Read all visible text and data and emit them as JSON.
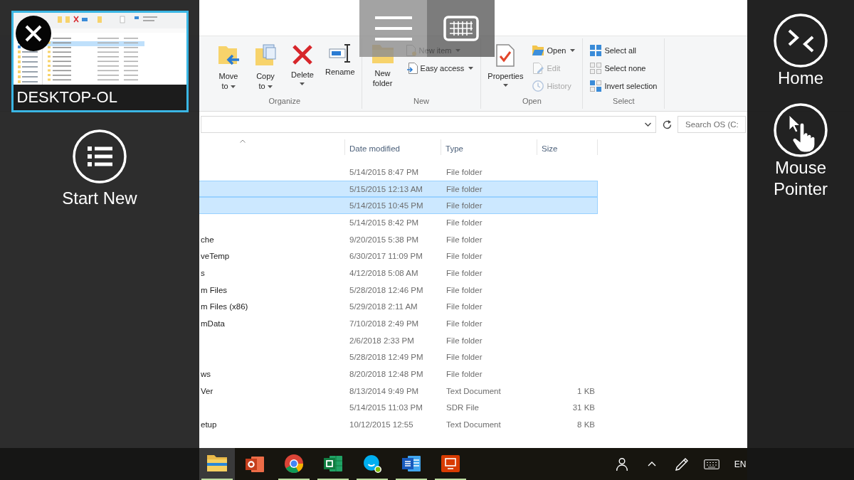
{
  "session_panel": {
    "sessions": [
      {
        "name": "DESKTOP-OL",
        "selected": true
      }
    ],
    "start_new": "Start New"
  },
  "action_panel": {
    "actions": [
      {
        "kind": "home",
        "label": "Home"
      },
      {
        "kind": "pointer",
        "label": "Mouse Pointer"
      }
    ]
  },
  "explorer": {
    "ribbon": {
      "groups": [
        {
          "label": "Organize",
          "commands": [
            {
              "kind": "large",
              "label": "Move to",
              "menu": true,
              "disabled": false
            },
            {
              "kind": "large",
              "label": "Copy to",
              "menu": true,
              "disabled": false
            },
            {
              "kind": "large",
              "label": "Delete",
              "menu": true,
              "disabled": false
            },
            {
              "kind": "large",
              "label": "Rename",
              "menu": false,
              "disabled": false
            }
          ]
        },
        {
          "label": "New",
          "commands": [
            {
              "kind": "large",
              "label": "New folder",
              "menu": false,
              "disabled": false
            },
            {
              "kind": "small",
              "label": "New item",
              "menu": true,
              "disabled": false
            },
            {
              "kind": "small",
              "label": "Easy access",
              "menu": true,
              "disabled": false
            }
          ]
        },
        {
          "label": "Open",
          "commands": [
            {
              "kind": "large",
              "label": "Properties",
              "menu": true,
              "disabled": false
            },
            {
              "kind": "small",
              "label": "Open",
              "menu": true,
              "disabled": false
            },
            {
              "kind": "small",
              "label": "Edit",
              "menu": false,
              "disabled": true
            },
            {
              "kind": "small",
              "label": "History",
              "menu": false,
              "disabled": true
            }
          ]
        },
        {
          "label": "Select",
          "commands": [
            {
              "kind": "small",
              "label": "Select all",
              "menu": false,
              "disabled": false
            },
            {
              "kind": "small",
              "label": "Select none",
              "menu": false,
              "disabled": false
            },
            {
              "kind": "small",
              "label": "Invert selection",
              "menu": false,
              "disabled": false
            }
          ]
        }
      ]
    },
    "search": {
      "placeholder": "Search OS (C:"
    },
    "file_list": {
      "columns": [
        {
          "sorted": true
        },
        {
          "label": "Date modified",
          "sorted": false
        },
        {
          "label": "Type",
          "sorted": false
        },
        {
          "label": "Size",
          "sorted": false
        }
      ],
      "rows": [
        {
          "date": "5/14/2015 8:47 PM",
          "type": "File folder",
          "selected": false
        },
        {
          "date": "5/15/2015 12:13 AM",
          "type": "File folder",
          "selected": true
        },
        {
          "date": "5/14/2015 10:45 PM",
          "type": "File folder",
          "selected": true
        },
        {
          "date": "5/14/2015 8:42 PM",
          "type": "File folder",
          "selected": false
        },
        {
          "name": "che",
          "date": "9/20/2015 5:38 PM",
          "type": "File folder",
          "selected": false
        },
        {
          "name": "veTemp",
          "date": "6/30/2017 11:09 PM",
          "type": "File folder",
          "selected": false
        },
        {
          "name": "s",
          "date": "4/12/2018 5:08 AM",
          "type": "File folder",
          "selected": false
        },
        {
          "name": "m Files",
          "date": "5/28/2018 12:46 PM",
          "type": "File folder",
          "selected": false
        },
        {
          "name": "m Files (x86)",
          "date": "5/29/2018 2:11 AM",
          "type": "File folder",
          "selected": false
        },
        {
          "name": "mData",
          "date": "7/10/2018 2:49 PM",
          "type": "File folder",
          "selected": false
        },
        {
          "date": "2/6/2018 2:33 PM",
          "type": "File folder",
          "selected": false
        },
        {
          "date": "5/28/2018 12:49 PM",
          "type": "File folder",
          "selected": false
        },
        {
          "name": "ws",
          "date": "8/20/2018 12:48 PM",
          "type": "File folder",
          "selected": false
        },
        {
          "name": "Ver",
          "date": "8/13/2014 9:49 PM",
          "type": "Text Document",
          "size": "1 KB",
          "selected": false
        },
        {
          "date": "5/14/2015 11:03 PM",
          "type": "SDR File",
          "size": "31 KB",
          "selected": false
        },
        {
          "name": "etup",
          "date": "10/12/2015 12:55",
          "type": "Text Document",
          "size": "8 KB",
          "selected": false
        }
      ]
    }
  },
  "taskbar": {
    "buttons": [
      {
        "kind": "files",
        "running": true,
        "active": true
      },
      {
        "kind": "slides",
        "running": false,
        "active": false
      },
      {
        "kind": "browser",
        "running": true,
        "active": false
      },
      {
        "kind": "sheets",
        "running": true,
        "active": false
      },
      {
        "kind": "chat",
        "running": true,
        "active": false
      },
      {
        "kind": "docs",
        "running": true,
        "active": false
      },
      {
        "kind": "screen",
        "running": true,
        "active": false
      }
    ],
    "language": "EN"
  }
}
